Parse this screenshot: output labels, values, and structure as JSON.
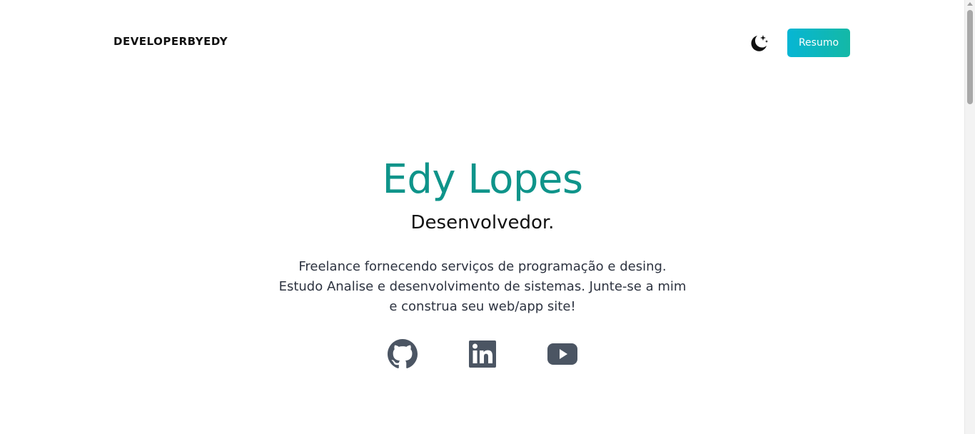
{
  "header": {
    "brand": "DEVELOPERBYEDY",
    "theme_toggle_icon": "moon-stars-icon",
    "resume_label": "Resumo"
  },
  "hero": {
    "name": "Edy Lopes",
    "role": "Desenvolvedor.",
    "description": "Freelance fornecendo serviços de programação e desing. Estudo Analise e desenvolvimento de sistemas. Junte-se a mim e construa seu web/app site!"
  },
  "social": [
    {
      "icon": "github-icon"
    },
    {
      "icon": "linkedin-icon"
    },
    {
      "icon": "youtube-icon"
    }
  ],
  "colors": {
    "accent": "#0f948a",
    "button_gradient_start": "#06b6d4",
    "button_gradient_end": "#14b8a6",
    "icon_gray": "#4b5563"
  }
}
